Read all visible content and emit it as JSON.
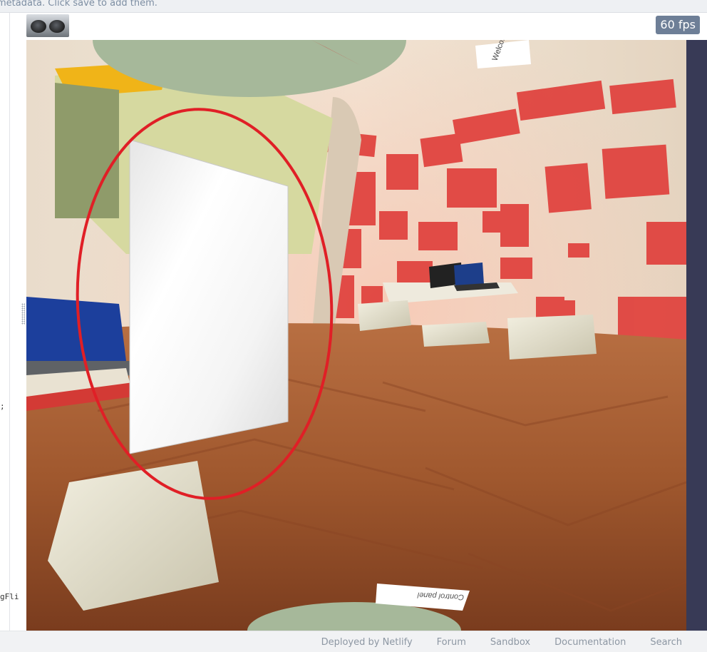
{
  "metadata_note": "metadata. Click save to add them.",
  "fps_counter": "60 fps",
  "code_fragments": [
    ";",
    "gFli"
  ],
  "scene_labels": {
    "top_sign": "Welcome",
    "bottom_sign": "Control panel"
  },
  "footer": {
    "links": [
      "Deployed by Netlify",
      "Forum",
      "Sandbox",
      "Documentation",
      "Search"
    ]
  },
  "colors": {
    "highlight_ring": "#e01f26",
    "floor_wood": "#a0582e",
    "wall_red": "#e0403c",
    "right_rail": "#383a56",
    "fps_badge": "#6e7f97"
  }
}
